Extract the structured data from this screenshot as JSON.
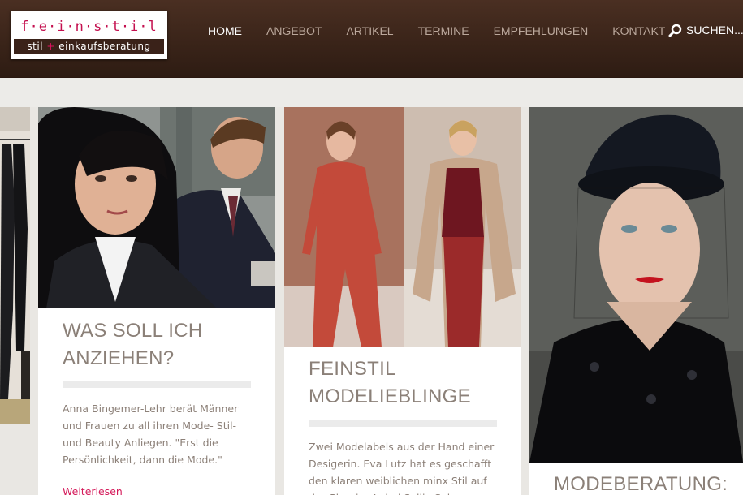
{
  "logo": {
    "top": "f·e·i·n·s·t·i·l",
    "bottom_left": "stil",
    "plus": "+",
    "bottom_right": "einkaufsberatung"
  },
  "nav": {
    "items": [
      "HOME",
      "ANGEBOT",
      "ARTIKEL",
      "TERMINE",
      "EMPFEHLUNGEN",
      "KONTAKT"
    ],
    "active": "HOME"
  },
  "search": {
    "label": "SUCHEN...",
    "icon": "search-icon"
  },
  "cards": [
    {
      "title_line1": "WAS SOLL ICH",
      "title_line2": "ANZIEHEN?",
      "text": "Anna Bingemer-Lehr berät Männer und Frauen zu all ihren Mode- Stil- und Beauty Anliegen. \"Erst die Persönlichkeit, dann die Mode.\"",
      "link": "Weiterlesen"
    },
    {
      "title_line1": "FEINSTIL",
      "title_line2": "MODELIEBLINGE",
      "text": "Zwei Modelabels aus der Hand einer Desigerin. Eva Lutz hat es geschafft den klaren weiblichen minx Stil auf das Plussize Label Sallie Sahne zu"
    },
    {
      "title_line1": "MODEBERATUNG:"
    }
  ],
  "colors": {
    "header": "#3a2419",
    "accent": "#d41a5a",
    "title": "#8b8078"
  }
}
